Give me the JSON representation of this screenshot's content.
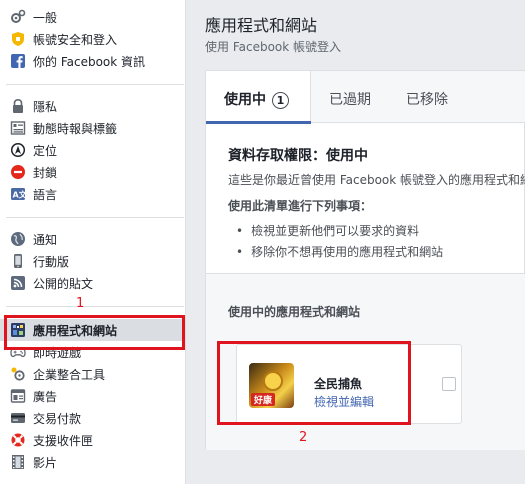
{
  "sidebar": {
    "groups": [
      [
        {
          "label": "一般",
          "icon": "gear-icon"
        },
        {
          "label": "帳號安全和登入",
          "icon": "shield-icon"
        },
        {
          "label": "你的 Facebook 資訊",
          "icon": "facebook-icon"
        }
      ],
      [
        {
          "label": "隱私",
          "icon": "lock-icon"
        },
        {
          "label": "動態時報與標籤",
          "icon": "timeline-icon"
        },
        {
          "label": "定位",
          "icon": "location-icon"
        },
        {
          "label": "封鎖",
          "icon": "block-icon"
        },
        {
          "label": "語言",
          "icon": "language-icon"
        }
      ],
      [
        {
          "label": "通知",
          "icon": "globe-icon"
        },
        {
          "label": "行動版",
          "icon": "mobile-icon"
        },
        {
          "label": "公開的貼文",
          "icon": "rss-icon"
        }
      ],
      [
        {
          "label": "應用程式和網站",
          "icon": "apps-icon",
          "selected": true
        },
        {
          "label": "即時遊戲",
          "icon": "gamepad-icon"
        },
        {
          "label": "企業整合工具",
          "icon": "business-icon"
        },
        {
          "label": "廣告",
          "icon": "ads-icon"
        },
        {
          "label": "交易付款",
          "icon": "payments-icon"
        },
        {
          "label": "支援收件匣",
          "icon": "support-icon"
        },
        {
          "label": "影片",
          "icon": "video-icon"
        }
      ]
    ]
  },
  "annotations": {
    "marker1": "1",
    "marker2": "2",
    "color": "#e0141e"
  },
  "main": {
    "title": "應用程式和網站",
    "subtitle": "使用 Facebook 帳號登入",
    "tabs": [
      {
        "label": "使用中",
        "badge": "1",
        "active": true
      },
      {
        "label": "已過期"
      },
      {
        "label": "已移除"
      }
    ],
    "access": {
      "title": "資料存取權限：使用中",
      "description": "這些是你最近曾使用 Facebook 帳號登入的應用程式和網站",
      "howto": "使用此清單進行下列事項：",
      "bullets": [
        "檢視並更新他們可以要求的資料",
        "移除你不想再使用的應用程式和網站"
      ]
    },
    "active_title": "使用中的應用程式和網站",
    "apps": [
      {
        "name": "全民捕魚",
        "action": "檢視並編輯",
        "thumb_tag": "好康"
      }
    ]
  },
  "colors": {
    "accent": "#4267b2",
    "sidebar_selected": "#dadde1",
    "page_bg": "#e9ebee"
  }
}
